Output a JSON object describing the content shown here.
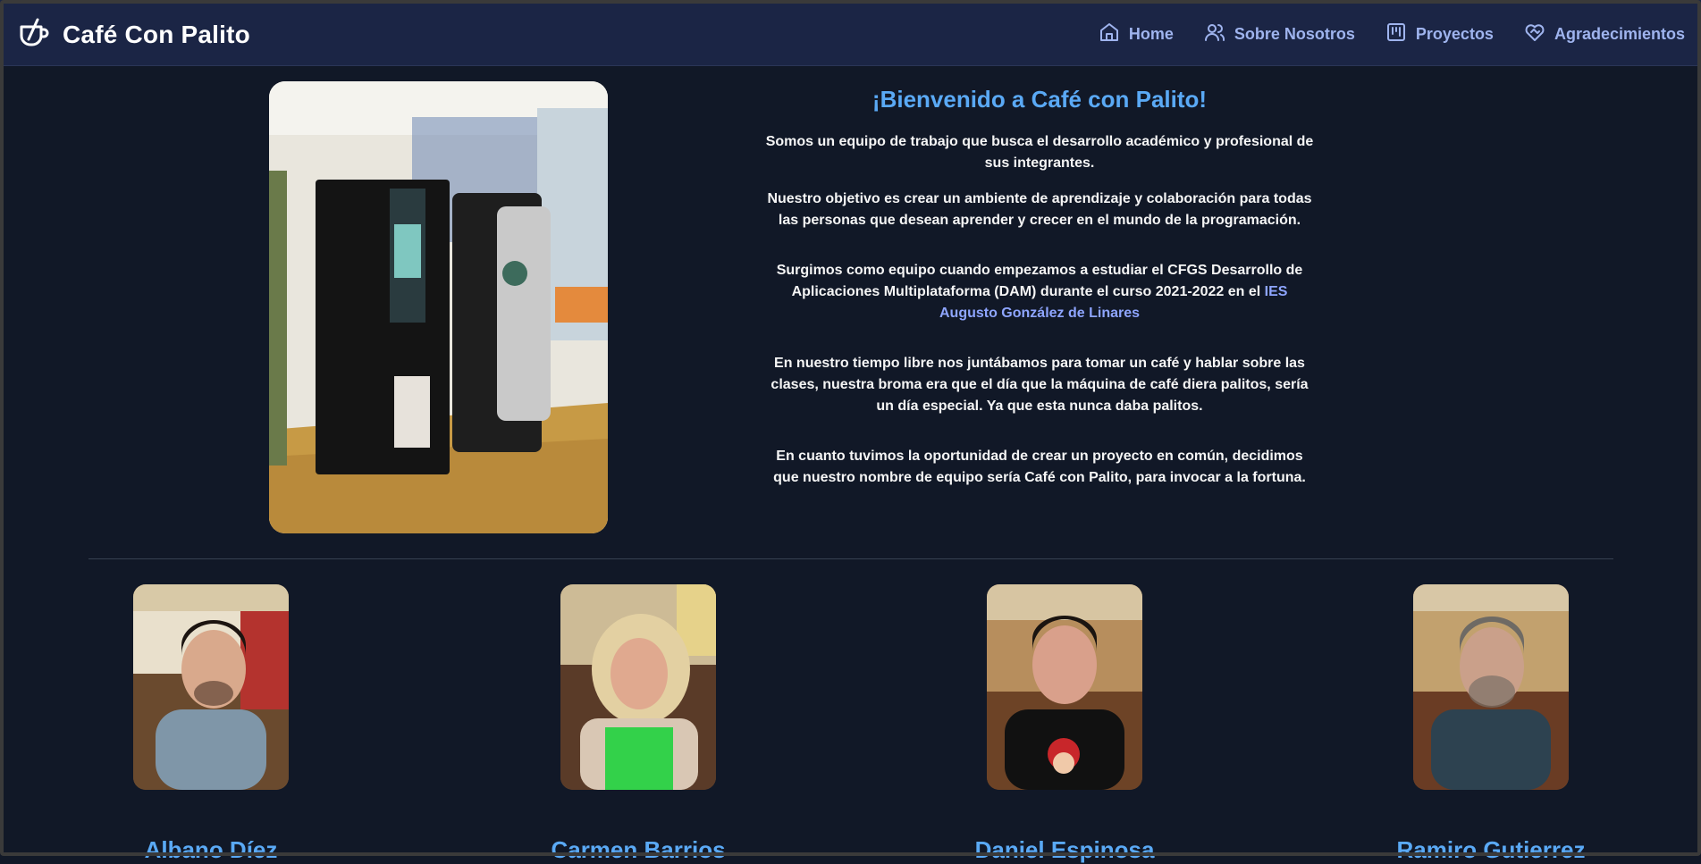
{
  "header": {
    "brand": "Café Con Palito",
    "nav": [
      {
        "label": "Home",
        "icon": "home-icon"
      },
      {
        "label": "Sobre Nosotros",
        "icon": "users-icon"
      },
      {
        "label": "Proyectos",
        "icon": "kanban-icon"
      },
      {
        "label": "Agradecimientos",
        "icon": "heart-handshake-icon"
      }
    ]
  },
  "intro": {
    "title": "¡Bienvenido a Café con Palito!",
    "p1": "Somos un equipo de trabajo que busca el desarrollo académico y profesional de sus integrantes.",
    "p2": "Nuestro objetivo es crear un ambiente de aprendizaje y colaboración para todas las personas que desean aprender y crecer en el mundo de la programación.",
    "p3": "Surgimos como equipo cuando empezamos a estudiar el CFGS Desarrollo de Aplicaciones Multiplataforma (DAM) durante el curso 2021-2022 en el",
    "p3_link": "IES Augusto González de Linares",
    "p4": "En nuestro tiempo libre nos juntábamos para tomar un café y hablar sobre las clases, nuestra broma era que el día que la máquina de café diera palitos, sería un día especial. Ya que esta nunca daba palitos.",
    "p5": "En cuanto tuvimos la oportunidad de crear un proyecto en común, decidimos que nuestro nombre de equipo sería Café con Palito, para invocar a la fortuna."
  },
  "team": [
    {
      "name": "Albano Díez"
    },
    {
      "name": "Carmen Barrios"
    },
    {
      "name": "Daniel Espinosa"
    },
    {
      "name": "Ramiro Gutierrez"
    }
  ],
  "colors": {
    "background": "#111827",
    "header": "#1b2545",
    "accent": "#5aa9f5",
    "nav_text": "#9fb4ee"
  }
}
